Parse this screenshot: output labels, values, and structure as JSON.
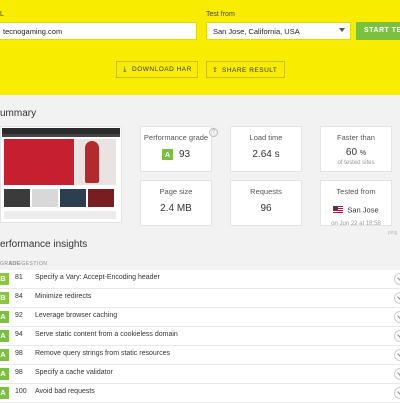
{
  "header": {
    "url_label": "L",
    "url_value": "tecnogaming.com",
    "from_label": "Test from",
    "from_value": "San Jose, California, USA",
    "start_label": "START TEST",
    "download_label": "DOWNLOAD HAR",
    "share_label": "SHARE RESULT",
    "colors": {
      "background": "#f8ec00",
      "accent": "#7ac142"
    }
  },
  "summary": {
    "title": "ummary",
    "performance": {
      "label": "Performance grade",
      "grade": "A",
      "score": "93"
    },
    "load_time": {
      "label": "Load time",
      "value": "2.64 s"
    },
    "faster_than": {
      "label": "Faster than",
      "value": "60",
      "unit": "%",
      "sub": "of tested sites"
    },
    "page_size": {
      "label": "Page size",
      "value": "2.4 MB"
    },
    "requests": {
      "label": "Requests",
      "value": "96"
    },
    "tested_from": {
      "label": "Tested from",
      "location": "San Jose",
      "date": "on Jun 22 at 18:58"
    },
    "note": "ping"
  },
  "insights": {
    "title": "erformance insights",
    "col_grade": "GRADE",
    "col_suggestion": "SUGGESTION",
    "rows": [
      {
        "grade": "B",
        "score": "81",
        "suggestion": "Specify a Vary: Accept-Encoding header"
      },
      {
        "grade": "B",
        "score": "84",
        "suggestion": "Minimize redirects"
      },
      {
        "grade": "A",
        "score": "92",
        "suggestion": "Leverage browser caching"
      },
      {
        "grade": "A",
        "score": "94",
        "suggestion": "Serve static content from a cookieless domain"
      },
      {
        "grade": "A",
        "score": "98",
        "suggestion": "Remove query strings from static resources"
      },
      {
        "grade": "A",
        "score": "98",
        "suggestion": "Specify a cache validator"
      },
      {
        "grade": "A",
        "score": "100",
        "suggestion": "Avoid bad requests"
      }
    ]
  }
}
